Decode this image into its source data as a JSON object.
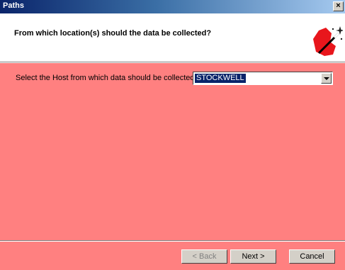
{
  "window": {
    "title": "Paths",
    "close_glyph": "×"
  },
  "header": {
    "question": "From which location(s) should the data be collected?",
    "icon": "magic-wand-icon"
  },
  "content": {
    "host_label": "Select the Host from which data should be collected:",
    "host_selected": "STOCKWELL",
    "background_color": "#ff8080"
  },
  "buttons": {
    "back": "< Back",
    "next": "Next >",
    "cancel": "Cancel"
  }
}
